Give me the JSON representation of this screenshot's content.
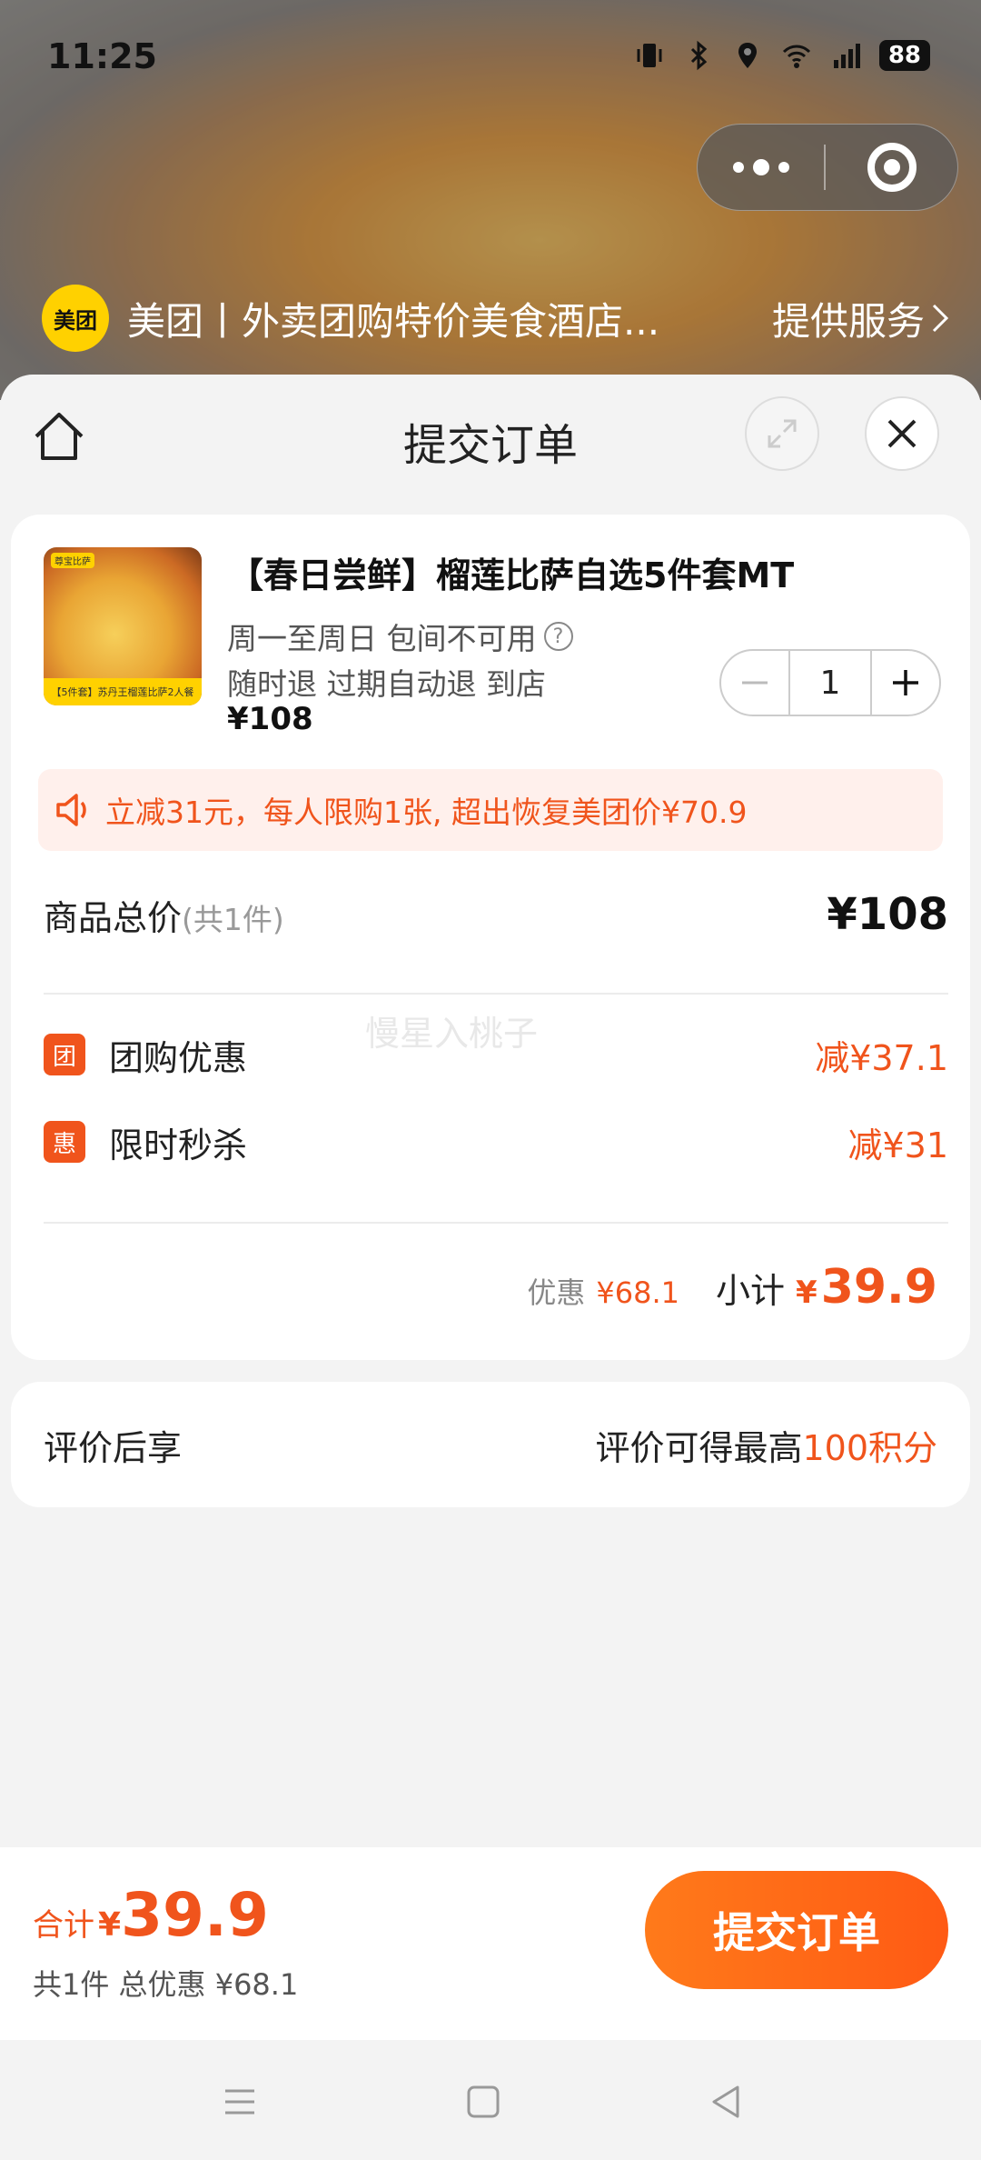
{
  "status_bar": {
    "time": "11:25",
    "battery": "88"
  },
  "app_bar": {
    "logo_text": "美团",
    "app_name": "美团丨外卖团购特价美食酒店...",
    "service_label": "提供服务"
  },
  "sheet": {
    "title": "提交订单"
  },
  "product": {
    "title": "【春日尝鲜】榴莲比萨自选5件套MT",
    "availability": "周一至周日 包间不可用",
    "refund_policy": "随时退 过期自动退 到店",
    "price": "¥108",
    "quantity": "1",
    "image_brand": "尊宝比萨",
    "image_caption": "【5件套】苏丹王榴莲比萨2人餐"
  },
  "promo": {
    "text": "立减31元，每人限购1张, 超出恢复美团价¥70.9"
  },
  "summary": {
    "total_label": "商品总价",
    "total_count": "(共1件)",
    "total_value": "¥108",
    "watermark": "慢星入桃子",
    "discounts": [
      {
        "badge": "团",
        "label": "团购优惠",
        "value": "减¥37.1"
      },
      {
        "badge": "惠",
        "label": "限时秒杀",
        "value": "减¥31"
      }
    ],
    "saving_label": "优惠",
    "saving_value": "¥68.1",
    "subtotal_label": "小计",
    "subtotal_currency": "¥",
    "subtotal_value": "39.9"
  },
  "review": {
    "left": "评价后享",
    "right_prefix": "评价可得最高",
    "right_highlight": "100积分"
  },
  "bottom": {
    "total_label": "合计",
    "currency": "¥",
    "total_value": "39.9",
    "detail": "共1件 总优惠 ¥68.1",
    "submit_label": "提交订单"
  },
  "colors": {
    "accent": "#f0541c",
    "button_start": "#ff7a1a",
    "button_end": "#ff5a14",
    "promo_bg": "#fff0ec",
    "brand_yellow": "#ffd100"
  }
}
